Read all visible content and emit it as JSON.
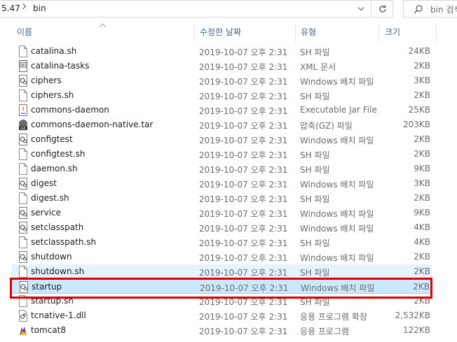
{
  "address": {
    "crumb1": "5.47",
    "crumb2": "bin"
  },
  "search": {
    "placeholder": "bin 검색"
  },
  "columns": {
    "name": "이름",
    "date": "수정한 날짜",
    "type": "유형",
    "size": "크기"
  },
  "files": [
    {
      "name": "catalina.sh",
      "date": "2019-10-07 오후 2:31",
      "type": "SH 파일",
      "size": "24KB",
      "icon": "file-icon"
    },
    {
      "name": "catalina-tasks",
      "date": "2019-10-07 오후 2:31",
      "type": "XML 문서",
      "size": "2KB",
      "icon": "xml-file-icon"
    },
    {
      "name": "ciphers",
      "date": "2019-10-07 오후 2:31",
      "type": "Windows 배치 파일",
      "size": "3KB",
      "icon": "batch-file-icon"
    },
    {
      "name": "ciphers.sh",
      "date": "2019-10-07 오후 2:31",
      "type": "SH 파일",
      "size": "2KB",
      "icon": "file-icon"
    },
    {
      "name": "commons-daemon",
      "date": "2019-10-07 오후 2:31",
      "type": "Executable Jar File",
      "size": "25KB",
      "icon": "jar-file-icon"
    },
    {
      "name": "commons-daemon-native.tar",
      "date": "2019-10-07 오후 2:31",
      "type": "압축(GZ) 파일",
      "size": "203KB",
      "icon": "gz-archive-icon"
    },
    {
      "name": "configtest",
      "date": "2019-10-07 오후 2:31",
      "type": "Windows 배치 파일",
      "size": "2KB",
      "icon": "batch-file-icon"
    },
    {
      "name": "configtest.sh",
      "date": "2019-10-07 오후 2:31",
      "type": "SH 파일",
      "size": "2KB",
      "icon": "file-icon"
    },
    {
      "name": "daemon.sh",
      "date": "2019-10-07 오후 2:31",
      "type": "SH 파일",
      "size": "9KB",
      "icon": "file-icon"
    },
    {
      "name": "digest",
      "date": "2019-10-07 오후 2:31",
      "type": "Windows 배치 파일",
      "size": "3KB",
      "icon": "batch-file-icon"
    },
    {
      "name": "digest.sh",
      "date": "2019-10-07 오후 2:31",
      "type": "SH 파일",
      "size": "2KB",
      "icon": "file-icon"
    },
    {
      "name": "service",
      "date": "2019-10-07 오후 2:31",
      "type": "Windows 배치 파일",
      "size": "9KB",
      "icon": "batch-file-icon"
    },
    {
      "name": "setclasspath",
      "date": "2019-10-07 오후 2:31",
      "type": "Windows 배치 파일",
      "size": "4KB",
      "icon": "batch-file-icon"
    },
    {
      "name": "setclasspath.sh",
      "date": "2019-10-07 오후 2:31",
      "type": "SH 파일",
      "size": "4KB",
      "icon": "file-icon"
    },
    {
      "name": "shutdown",
      "date": "2019-10-07 오후 2:31",
      "type": "Windows 배치 파일",
      "size": "2KB",
      "icon": "batch-file-icon"
    },
    {
      "name": "shutdown.sh",
      "date": "2019-10-07 오후 2:31",
      "type": "SH 파일",
      "size": "2KB",
      "icon": "file-icon",
      "state": "hover"
    },
    {
      "name": "startup",
      "date": "2019-10-07 오후 2:31",
      "type": "Windows 배치 파일",
      "size": "2KB",
      "icon": "batch-file-icon",
      "state": "selected"
    },
    {
      "name": "startup.sh",
      "date": "2019-10-07 오후 2:31",
      "type": "SH 파일",
      "size": "2KB",
      "icon": "file-icon"
    },
    {
      "name": "tcnative-1.dll",
      "date": "2019-10-07 오후 2:31",
      "type": "응용 프로그램 확장",
      "size": "2,532KB",
      "icon": "dll-file-icon"
    },
    {
      "name": "tomcat8",
      "date": "2019-10-07 오후 2:31",
      "type": "응용 프로그램",
      "size": "122KB",
      "icon": "tomcat-app-icon"
    }
  ],
  "colors": {
    "selected_bg": "#cce8ff",
    "hover_bg": "#e5f3ff",
    "highlight": "#e00000",
    "header_text": "#4c607a"
  }
}
